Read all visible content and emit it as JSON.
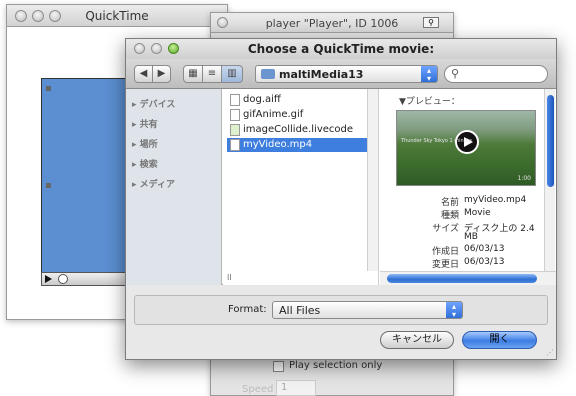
{
  "qt_window": {
    "title": "QuickTime",
    "movie_color": "#5b8fd1"
  },
  "player_window": {
    "title": "player \"Player\", ID 1006",
    "play_selection_label": "Play selection only",
    "speed_label": "Speed",
    "speed_value": "1"
  },
  "dialog": {
    "title": "Choose a QuickTime movie:",
    "folder": "maltiMedia13",
    "sidebar": [
      "デバイス",
      "共有",
      "場所",
      "検索",
      "メディア"
    ],
    "files": [
      {
        "name": "dog.aiff",
        "selected": false
      },
      {
        "name": "gifAnime.gif",
        "selected": false
      },
      {
        "name": "imageCollide.livecode",
        "selected": false
      },
      {
        "name": "myVideo.mp4",
        "selected": true
      }
    ],
    "preview_label": "▼プレビュー：",
    "preview_caption_left": "Thunder Sky Tokyo 1 minute",
    "preview_time": "1:00",
    "meta": [
      {
        "key": "名前",
        "value": "myVideo.mp4"
      },
      {
        "key": "種類",
        "value": "Movie"
      },
      {
        "key": "サイズ",
        "value": "ディスク上の 2.4"
      },
      {
        "key": "",
        "value": "MB"
      },
      {
        "key": "作成日",
        "value": "06/03/13"
      },
      {
        "key": "変更日",
        "value": "06/03/13"
      }
    ],
    "format_label": "Format:",
    "format_value": "All Files",
    "cancel_label": "キャンセル",
    "open_label": "開く"
  }
}
